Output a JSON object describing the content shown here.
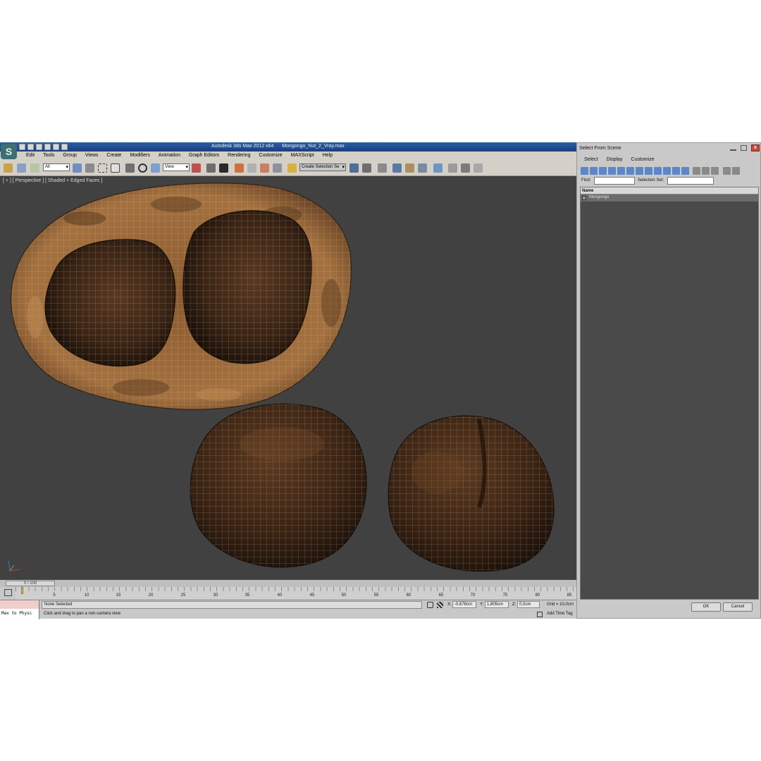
{
  "app": {
    "logo_glyph": "S",
    "title_name": "Autodesk 3ds Max  2012 x64",
    "title_file": "Mongongo_Nut_2_Vray.max"
  },
  "menu": [
    "Edit",
    "Tools",
    "Group",
    "Views",
    "Create",
    "Modifiers",
    "Animation",
    "Graph Editors",
    "Rendering",
    "Customize",
    "MAXScript",
    "Help"
  ],
  "toolbar": {
    "filter_value": "All",
    "refcoord_value": "View",
    "named_selection_placeholder": "Create Selection Se"
  },
  "viewport": {
    "label": "[ + ] [ Perspective ] [ Shaded + Edged Faces ]",
    "background": "#414141",
    "wire_color": "#d9cfc0"
  },
  "timeline": {
    "frame_counter": "0 / 100",
    "ticks": [
      "5",
      "10",
      "15",
      "20",
      "25",
      "30",
      "35",
      "40",
      "45",
      "50",
      "55",
      "60",
      "65",
      "70",
      "75",
      "80",
      "85"
    ]
  },
  "status": {
    "maxscript_text": "Max to Physc",
    "selection_status": "None Selected",
    "prompt": "Click and drag to pan a non-camera view",
    "x_label": "X:",
    "x_value": "-0,678cm",
    "y_label": "Y:",
    "y_value": "1,805cm",
    "z_label": "Z:",
    "z_value": "0,0cm",
    "grid": "Grid = 10,0cm",
    "time_tag": "Add Time Tag"
  },
  "dialog": {
    "title": "Select From Scene",
    "close_glyph": "x",
    "menu": [
      "Select",
      "Display",
      "Customize"
    ],
    "find_label": "Find:",
    "selection_set_label": "Selection Set:",
    "column_name": "Name",
    "items": [
      "Mongongo"
    ],
    "ok_label": "OK",
    "cancel_label": "Cancel"
  }
}
